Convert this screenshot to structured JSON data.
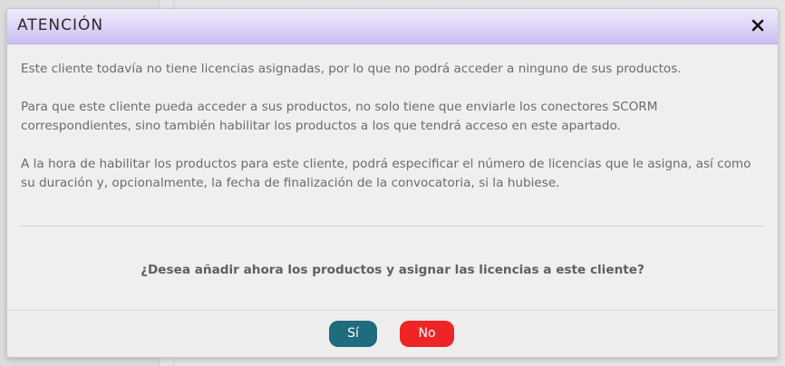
{
  "dialog": {
    "title": "ATENCIÓN",
    "close_icon": "close-icon",
    "paragraphs": [
      "Este cliente todavía no tiene licencias asignadas, por lo que no podrá acceder a ninguno de sus productos.",
      "Para que este cliente pueda acceder a sus productos, no solo tiene que enviarle los conectores SCORM correspondientes, sino también habilitar los productos a los que tendrá acceso en este apartado.",
      "A la hora de habilitar los productos para este cliente, podrá especificar el número de licencias que le asigna, así como su duración y, opcionalmente, la fecha de finalización de la convocatoria, si la hubiese."
    ],
    "question": "¿Desea añadir ahora los productos y asignar las licencias a este cliente?",
    "buttons": {
      "yes": "Sí",
      "no": "No"
    },
    "colors": {
      "yes": "#1e6c7d",
      "no": "#ef2424",
      "header": "#ddd3f6"
    }
  }
}
